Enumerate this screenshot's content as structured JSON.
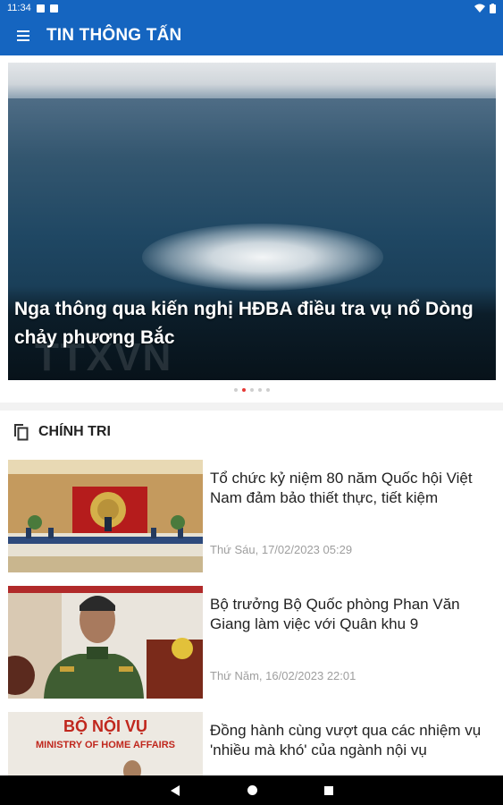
{
  "status_bar": {
    "time": "11:34"
  },
  "app_bar": {
    "title": "TIN THÔNG TẤN",
    "menu_icon": "hamburger-menu-icon"
  },
  "hero": {
    "title": "Nga thông qua kiến nghị HĐBA điều tra vụ nổ Dòng chảy phương Bắc",
    "watermark": "TTXVN",
    "slide_count": 5,
    "active_slide": 2
  },
  "section": {
    "title": "CHÍNH TRI",
    "icon": "copy-icon"
  },
  "articles": [
    {
      "title": "Tổ chức kỷ niệm 80 năm Quốc hội Việt Nam đảm bảo thiết thực, tiết kiệm",
      "date": "Thứ Sáu, 17/02/2023 05:29"
    },
    {
      "title": "Bộ trưởng Bộ Quốc phòng Phan Văn Giang làm việc với Quân khu 9",
      "date": "Thứ Năm, 16/02/2023 22:01"
    },
    {
      "title": "Đồng hành cùng vượt qua các nhiệm vụ 'nhiều mà khó' của ngành nội vụ",
      "date": "",
      "thumb_text_1": "BỘ NỘI VỤ",
      "thumb_text_2": "MINISTRY OF HOME AFFAIRS"
    }
  ],
  "colors": {
    "primary": "#1565c0",
    "active_dot": "#e53935"
  }
}
